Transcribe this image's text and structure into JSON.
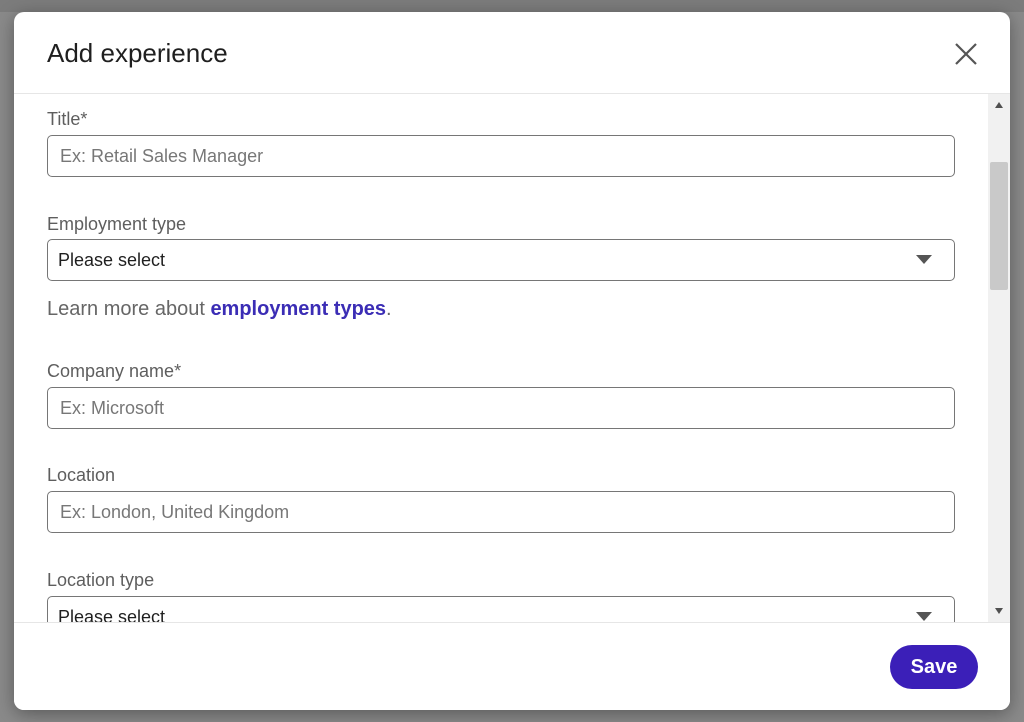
{
  "modal": {
    "title": "Add experience",
    "close_icon": "close-icon"
  },
  "form": {
    "title_field": {
      "label": "Title*",
      "placeholder": "Ex: Retail Sales Manager"
    },
    "employment_type": {
      "label": "Employment type",
      "value": "Please select"
    },
    "learn_more": {
      "prefix": "Learn more about ",
      "link": "employment types",
      "suffix": "."
    },
    "company_name": {
      "label": "Company name*",
      "placeholder": "Ex: Microsoft"
    },
    "location": {
      "label": "Location",
      "placeholder": "Ex: London, United Kingdom"
    },
    "location_type": {
      "label": "Location type",
      "value": "Please select"
    }
  },
  "footer": {
    "save_label": "Save"
  },
  "colors": {
    "primary": "#3b1fb8",
    "link": "#3b2db5"
  }
}
